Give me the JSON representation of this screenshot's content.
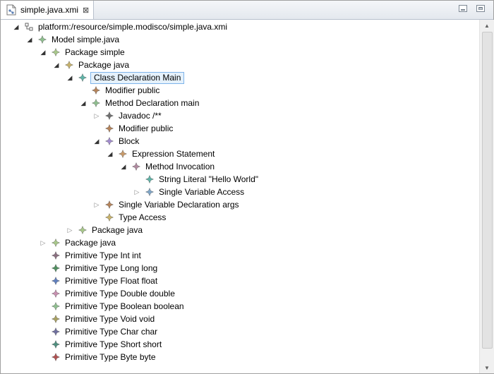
{
  "tab": {
    "title": "simple.java.xmi",
    "close_glyph": "⊠"
  },
  "tree": [
    {
      "label": "platform:/resource/simple.modisco/simple.java.xmi",
      "icon": "resource-icon",
      "depth": 0,
      "toggle": "open",
      "color": "#555555"
    },
    {
      "label": "Model simple.java",
      "icon": "model-icon",
      "depth": 1,
      "toggle": "open",
      "color": "#8fbf8f"
    },
    {
      "label": "Package simple",
      "icon": "package-icon",
      "depth": 2,
      "toggle": "open",
      "color": "#a8c88a"
    },
    {
      "label": "Package java",
      "icon": "package-icon",
      "depth": 3,
      "toggle": "open",
      "color": "#c8b26a"
    },
    {
      "label": "Class Declaration Main",
      "icon": "class-declaration-icon",
      "depth": 4,
      "toggle": "open",
      "color": "#5fb3a7",
      "selected": true
    },
    {
      "label": "Modifier public",
      "icon": "modifier-icon",
      "depth": 5,
      "toggle": "none",
      "color": "#b5835a"
    },
    {
      "label": "Method Declaration main",
      "icon": "method-declaration-icon",
      "depth": 5,
      "toggle": "open",
      "color": "#8fbf8f"
    },
    {
      "label": "Javadoc /**",
      "icon": "javadoc-icon",
      "depth": 6,
      "toggle": "closed",
      "color": "#6f6f6f"
    },
    {
      "label": "Modifier public",
      "icon": "modifier-icon",
      "depth": 6,
      "toggle": "none",
      "color": "#b5835a"
    },
    {
      "label": "Block",
      "icon": "block-icon",
      "depth": 6,
      "toggle": "open",
      "color": "#a38ccf"
    },
    {
      "label": "Expression Statement",
      "icon": "expression-statement-icon",
      "depth": 7,
      "toggle": "open",
      "color": "#c89a6a"
    },
    {
      "label": "Method Invocation",
      "icon": "method-invocation-icon",
      "depth": 8,
      "toggle": "open",
      "color": "#b08aa0"
    },
    {
      "label": "String Literal \"Hello World\"",
      "icon": "string-literal-icon",
      "depth": 9,
      "toggle": "none",
      "color": "#5fb3a7"
    },
    {
      "label": "Single Variable Access",
      "icon": "variable-access-icon",
      "depth": 9,
      "toggle": "closed",
      "color": "#7fa6c8"
    },
    {
      "label": "Single Variable Declaration args",
      "icon": "variable-declaration-icon",
      "depth": 6,
      "toggle": "closed",
      "color": "#b5835a"
    },
    {
      "label": "Type Access",
      "icon": "type-access-icon",
      "depth": 6,
      "toggle": "none",
      "color": "#c8b26a"
    },
    {
      "label": "Package java",
      "icon": "package-icon",
      "depth": 4,
      "toggle": "closed",
      "color": "#a8c88a"
    },
    {
      "label": "Package java",
      "icon": "package-icon",
      "depth": 2,
      "toggle": "closed",
      "color": "#a8c88a"
    },
    {
      "label": "Primitive Type Int int",
      "icon": "primitive-type-icon",
      "depth": 2,
      "toggle": "none",
      "color": "#8a6f80"
    },
    {
      "label": "Primitive Type Long long",
      "icon": "primitive-type-icon",
      "depth": 2,
      "toggle": "none",
      "color": "#4f8f5f"
    },
    {
      "label": "Primitive Type Float float",
      "icon": "primitive-type-icon",
      "depth": 2,
      "toggle": "none",
      "color": "#5f7fbf"
    },
    {
      "label": "Primitive Type Double double",
      "icon": "primitive-type-icon",
      "depth": 2,
      "toggle": "none",
      "color": "#c890b0"
    },
    {
      "label": "Primitive Type Boolean boolean",
      "icon": "primitive-type-icon",
      "depth": 2,
      "toggle": "none",
      "color": "#8fbf8f"
    },
    {
      "label": "Primitive Type Void void",
      "icon": "primitive-type-icon",
      "depth": 2,
      "toggle": "none",
      "color": "#a8a060"
    },
    {
      "label": "Primitive Type Char char",
      "icon": "primitive-type-icon",
      "depth": 2,
      "toggle": "none",
      "color": "#6f6f9f"
    },
    {
      "label": "Primitive Type Short short",
      "icon": "primitive-type-icon",
      "depth": 2,
      "toggle": "none",
      "color": "#4f8f7f"
    },
    {
      "label": "Primitive Type Byte byte",
      "icon": "primitive-type-icon",
      "depth": 2,
      "toggle": "none",
      "color": "#b05050"
    }
  ]
}
